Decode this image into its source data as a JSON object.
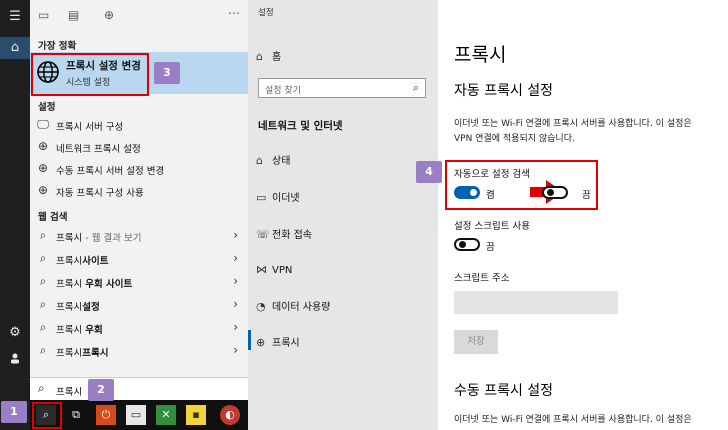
{
  "start_menu": {
    "rail_icons": [
      "hamburger-icon",
      "home-icon",
      "gear-icon",
      "user-icon"
    ],
    "section_best": "가장 정확",
    "best_match": {
      "title": "프록시 설정 변경",
      "subtitle": "시스템 설정"
    },
    "section_settings": "설정",
    "settings_items": [
      {
        "icon": "monitor-icon",
        "label": "프록시 서버 구성"
      },
      {
        "icon": "globe-icon",
        "label": "네트워크 프록시 설정"
      },
      {
        "icon": "globe-icon",
        "label": "수동 프록시 서버 설정 변경"
      },
      {
        "icon": "globe-icon",
        "label": "자동 프록시 구성 사용"
      }
    ],
    "section_web": "웹 검색",
    "web_items": [
      {
        "label_main": "프록시",
        "label_sub": " - 웹 결과 보기"
      },
      {
        "label_main": "프록시",
        "label_bold": "사이트"
      },
      {
        "label_main": "프록시 ",
        "label_bold": "우회 사이트"
      },
      {
        "label_main": "프록시",
        "label_bold": "설정"
      },
      {
        "label_main": "프록시 ",
        "label_bold": "우회"
      },
      {
        "label_main": "프록시",
        "label_bold": "프록시"
      }
    ],
    "search_value": "프록시"
  },
  "callouts": [
    "1",
    "2",
    "3",
    "4"
  ],
  "settings": {
    "window_title": "설정",
    "home": "홈",
    "search_placeholder": "설정 찾기",
    "category": "네트워크 및 인터넷",
    "nav_items": [
      {
        "icon": "status-icon",
        "label": "상태"
      },
      {
        "icon": "ethernet-icon",
        "label": "이더넷"
      },
      {
        "icon": "dialup-icon",
        "label": "전화 접속"
      },
      {
        "icon": "vpn-icon",
        "label": "VPN"
      },
      {
        "icon": "data-usage-icon",
        "label": "데이터 사용량"
      },
      {
        "icon": "globe-icon",
        "label": "프록시"
      }
    ],
    "active_nav": "프록시"
  },
  "proxy": {
    "title": "프록시",
    "auto_heading": "자동 프록시 설정",
    "auto_desc_1": "이더넷 또는 Wi-Fi 연결에 프록시 서버를 사용합니다. 이 설정은",
    "auto_desc_2": "VPN 연결에 적용되지 않습니다.",
    "auto_detect_label": "자동으로 설정 검색",
    "toggle_on_text": "켬",
    "toggle_off_text": "끔",
    "auto_detect_state": "on",
    "auto_detect_after_state": "off",
    "script_label": "설정 스크립트 사용",
    "script_state": "off",
    "script_address_label": "스크립트 주소",
    "save_label": "저장",
    "manual_heading": "수동 프록시 설정",
    "manual_desc": "이더넷 또는 Wi-Fi 연결에 프록시 서버를 사용합니다. 이 설정은"
  },
  "colors": {
    "accent": "#0063b1",
    "highlight": "#b9d8f0",
    "callout": "#9b7fc4",
    "annotation": "#e00000"
  }
}
